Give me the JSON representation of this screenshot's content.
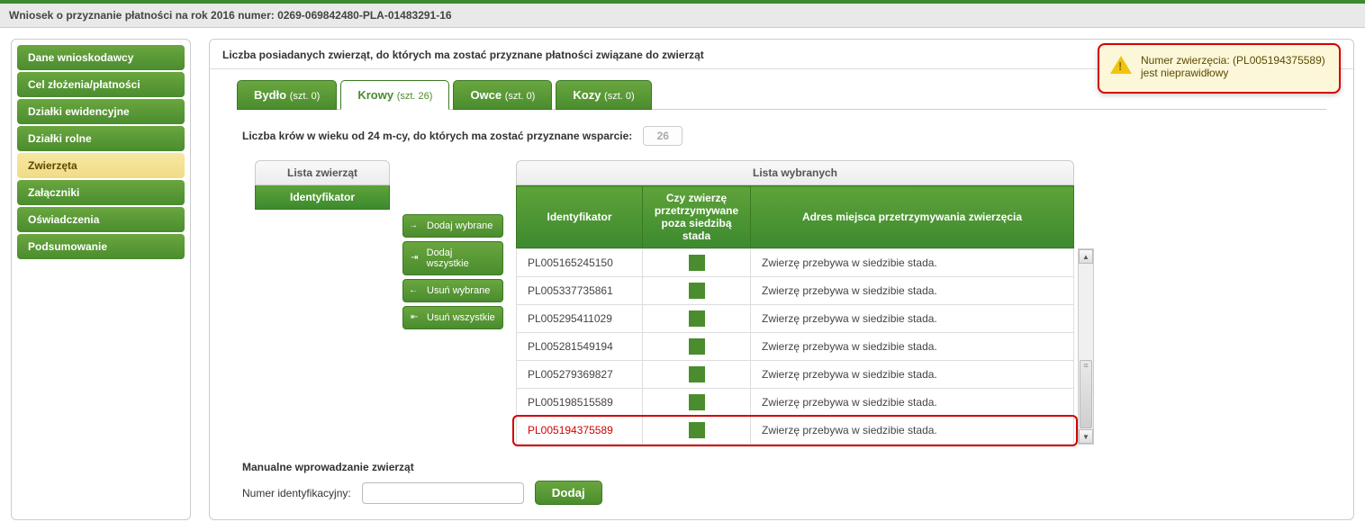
{
  "header": {
    "title": "Wniosek o przyznanie płatności na rok 2016 numer: 0269-069842480-PLA-01483291-16"
  },
  "sidebar": {
    "items": [
      {
        "label": "Dane wnioskodawcy",
        "active": false
      },
      {
        "label": "Cel złożenia/płatności",
        "active": false
      },
      {
        "label": "Działki ewidencyjne",
        "active": false
      },
      {
        "label": "Działki rolne",
        "active": false
      },
      {
        "label": "Zwierzęta",
        "active": true
      },
      {
        "label": "Załączniki",
        "active": false
      },
      {
        "label": "Oświadczenia",
        "active": false
      },
      {
        "label": "Podsumowanie",
        "active": false
      }
    ]
  },
  "section": {
    "title": "Liczba posiadanych zwierząt, do których ma zostać przyznane płatności związane do zwierząt"
  },
  "tabs": [
    {
      "label": "Bydło",
      "count_label": "(szt. 0)",
      "active": false
    },
    {
      "label": "Krowy",
      "count_label": "(szt. 26)",
      "active": true
    },
    {
      "label": "Owce",
      "count_label": "(szt. 0)",
      "active": false
    },
    {
      "label": "Kozy",
      "count_label": "(szt. 0)",
      "active": false
    }
  ],
  "age_row": {
    "label": "Liczba krów w wieku od 24 m-cy, do których ma zostać przyznane wsparcie:",
    "value": "26"
  },
  "lists": {
    "left_title": "Lista zwierząt",
    "left_col": "Identyfikator",
    "right_title": "Lista wybranych",
    "columns": {
      "id": "Identyfikator",
      "outside": "Czy zwierzę przetrzymywane poza siedzibą stada",
      "address": "Adres miejsca przetrzymywania zwierzęcia"
    }
  },
  "actions": {
    "add_sel": "Dodaj wybrane",
    "add_all": "Dodaj wszystkie",
    "rem_sel": "Usuń wybrane",
    "rem_all": "Usuń wszystkie"
  },
  "rows": [
    {
      "id": "PL005165245150",
      "addr": "Zwierzę przebywa w siedzibie stada.",
      "invalid": false
    },
    {
      "id": "PL005337735861",
      "addr": "Zwierzę przebywa w siedzibie stada.",
      "invalid": false
    },
    {
      "id": "PL005295411029",
      "addr": "Zwierzę przebywa w siedzibie stada.",
      "invalid": false
    },
    {
      "id": "PL005281549194",
      "addr": "Zwierzę przebywa w siedzibie stada.",
      "invalid": false
    },
    {
      "id": "PL005279369827",
      "addr": "Zwierzę przebywa w siedzibie stada.",
      "invalid": false
    },
    {
      "id": "PL005198515589",
      "addr": "Zwierzę przebywa w siedzibie stada.",
      "invalid": false
    },
    {
      "id": "PL005194375589",
      "addr": "Zwierzę przebywa w siedzibie stada.",
      "invalid": true
    }
  ],
  "manual": {
    "title": "Manualne wprowadzanie zwierząt",
    "label": "Numer identyfikacyjny:",
    "button": "Dodaj"
  },
  "toast": {
    "text": "Numer zwierzęcia: (PL005194375589) jest nieprawidłowy"
  }
}
